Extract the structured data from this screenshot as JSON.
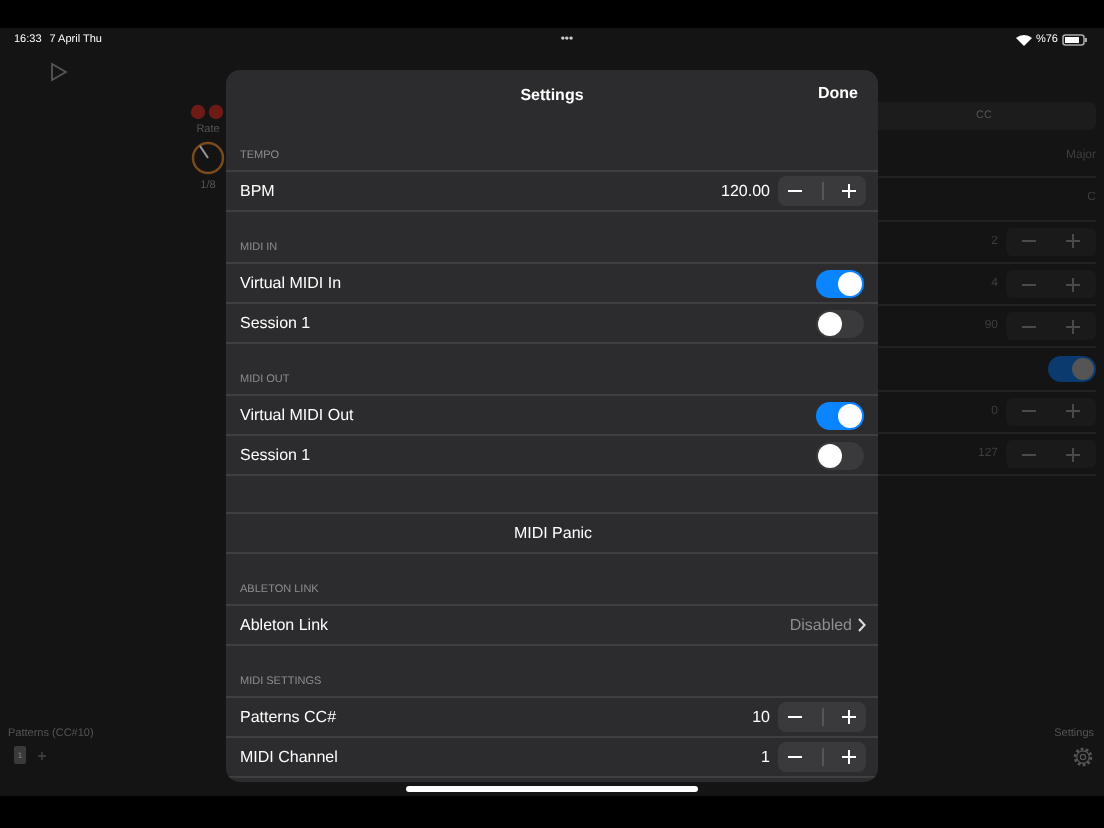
{
  "status_bar": {
    "time": "16:33",
    "date": "7 April Thu",
    "multitask": "•••",
    "battery": "%76"
  },
  "background": {
    "rate_label": "Rate",
    "rate_value": "1/8",
    "tab": "CC",
    "rows": [
      {
        "kind": "value",
        "value": "Major"
      },
      {
        "kind": "value",
        "value": "C"
      },
      {
        "kind": "stepper",
        "value": "2"
      },
      {
        "kind": "stepper",
        "value": "4"
      },
      {
        "kind": "stepper",
        "value": "90"
      },
      {
        "kind": "toggle",
        "on": true
      },
      {
        "kind": "stepper",
        "value": "0"
      },
      {
        "kind": "stepper",
        "value": "127"
      }
    ],
    "patterns_label": "Patterns (CC#10)",
    "patterns": [
      {
        "label": "1",
        "selected": true
      }
    ],
    "settings_label": "Settings"
  },
  "sheet": {
    "title": "Settings",
    "done": "Done",
    "sections": [
      {
        "header": "TEMPO",
        "rows": [
          {
            "kind": "stepper",
            "label": "BPM",
            "value": "120.00"
          }
        ]
      },
      {
        "header": "MIDI IN",
        "rows": [
          {
            "kind": "toggle",
            "label": "Virtual MIDI In",
            "on": true
          },
          {
            "kind": "toggle",
            "label": "Session 1",
            "on": false
          }
        ]
      },
      {
        "header": "MIDI OUT",
        "rows": [
          {
            "kind": "toggle",
            "label": "Virtual MIDI Out",
            "on": true
          },
          {
            "kind": "toggle",
            "label": "Session 1",
            "on": false
          }
        ]
      },
      {
        "rows": [
          {
            "kind": "action",
            "label": "MIDI Panic"
          }
        ]
      },
      {
        "header": "ABLETON LINK",
        "rows": [
          {
            "kind": "link",
            "label": "Ableton Link",
            "value": "Disabled"
          }
        ]
      },
      {
        "header": "MIDI SETTINGS",
        "rows": [
          {
            "kind": "stepper",
            "label": "Patterns CC#",
            "value": "10"
          },
          {
            "kind": "stepper",
            "label": "MIDI Channel",
            "value": "1"
          }
        ]
      }
    ]
  }
}
